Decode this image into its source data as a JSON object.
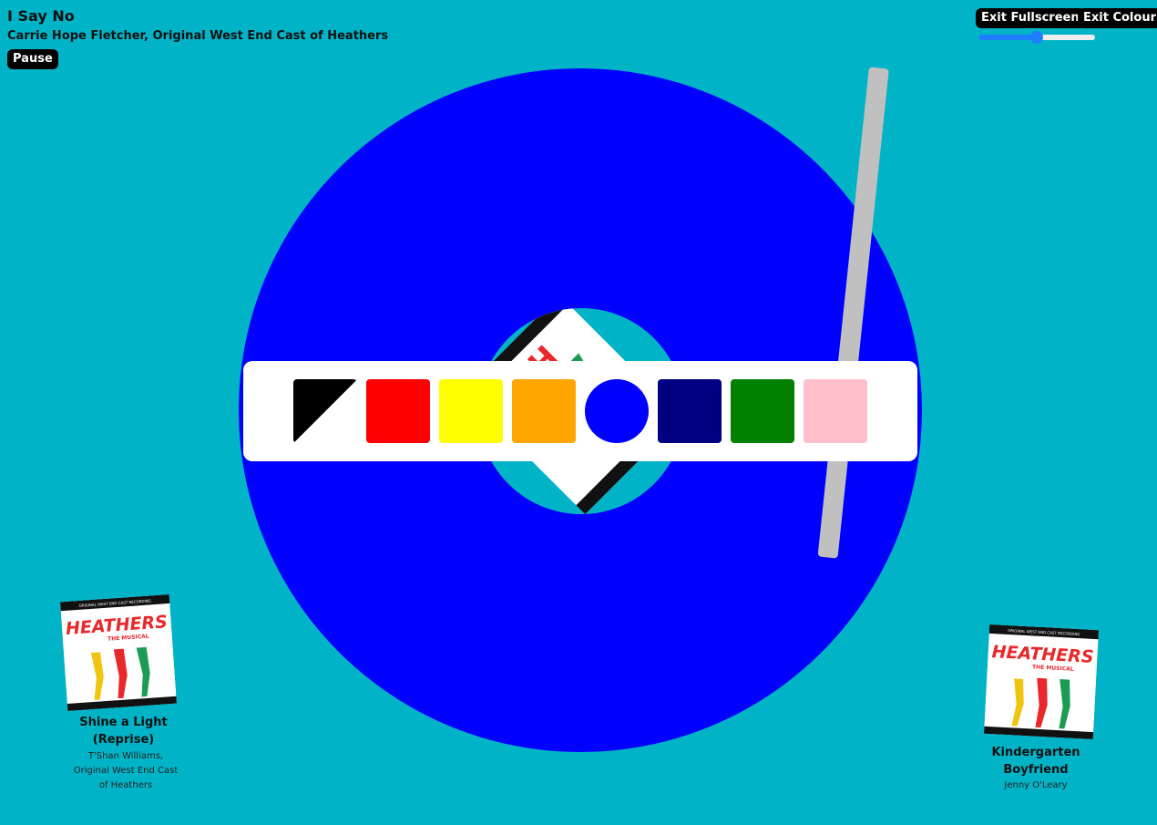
{
  "now_playing": {
    "title": "I Say No",
    "artist": "Carrie Hope Fletcher, Original West End Cast of Heathers"
  },
  "controls": {
    "pause_label": "Pause",
    "exit_fullscreen_label": "Exit Fullscreen",
    "exit_colour_label": "Exit Colour",
    "volume": 0.5
  },
  "colours": {
    "background": "#00b3c6",
    "record": "#0000ff",
    "tonearm": "#c0c0c0",
    "swatches": [
      "black-white-split",
      "#ff0000",
      "#ffff00",
      "#ffa500",
      "#0000ff",
      "#000080",
      "#008000",
      "#ffc0cb"
    ],
    "selected_swatch": "#0000ff"
  },
  "album_art": {
    "title_text": "HEATHERS",
    "subtitle_text": "THE MUSICAL",
    "top_text": "ORIGINAL WEST END CAST RECORDING"
  },
  "queue": {
    "previous": {
      "title": "Shine a Light (Reprise)",
      "artist": "T'Shan Williams, Original West End Cast of Heathers"
    },
    "next": {
      "title": "Kindergarten Boyfriend",
      "artist": "Jenny O'Leary"
    }
  }
}
